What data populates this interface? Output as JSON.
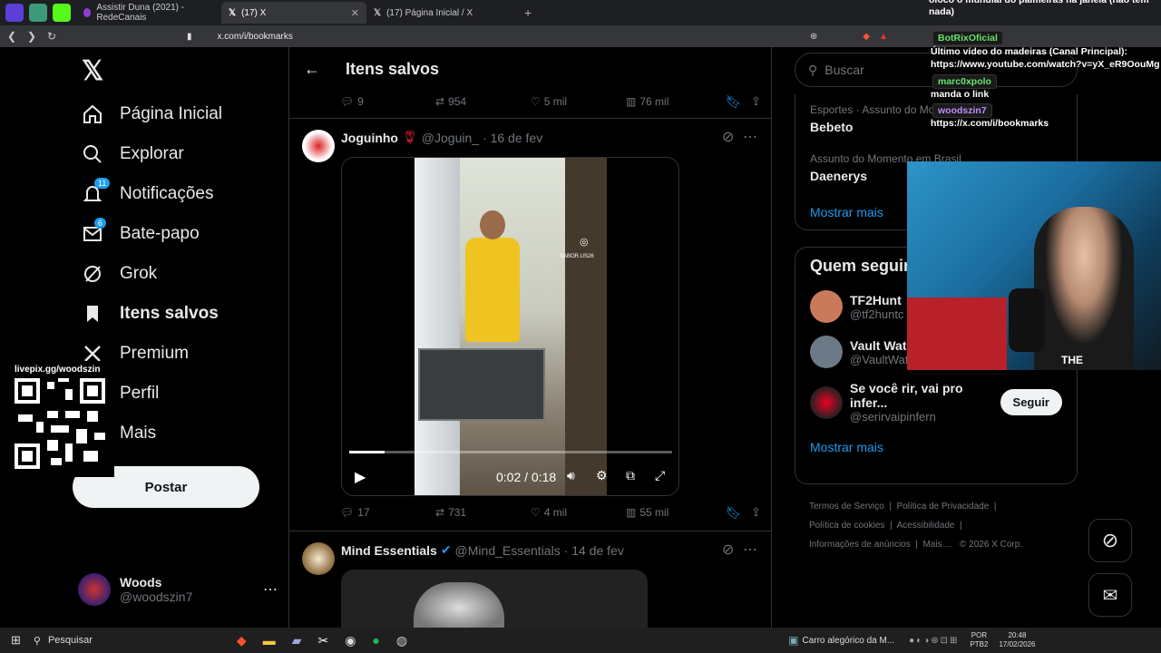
{
  "browser": {
    "tabs": [
      {
        "title": "Assistir Duna (2021) - RedeCanais",
        "active": false
      },
      {
        "title": "(17) X",
        "active": true
      },
      {
        "title": "(17) Página Inicial / X",
        "active": false
      }
    ],
    "url": "x.com/i/bookmarks"
  },
  "nav": {
    "items": [
      {
        "label": "Página Inicial",
        "icon": "home-icon",
        "badge": ""
      },
      {
        "label": "Explorar",
        "icon": "search-icon",
        "badge": ""
      },
      {
        "label": "Notificações",
        "icon": "bell-icon",
        "badge": "11"
      },
      {
        "label": "Bate-papo",
        "icon": "mail-icon",
        "badge": "6"
      },
      {
        "label": "Grok",
        "icon": "grok-icon",
        "badge": ""
      },
      {
        "label": "Itens salvos",
        "icon": "bookmark-icon",
        "badge": ""
      },
      {
        "label": "Premium",
        "icon": "x-icon",
        "badge": ""
      },
      {
        "label": "Perfil",
        "icon": "person-icon",
        "badge": ""
      },
      {
        "label": "Mais",
        "icon": "more-icon",
        "badge": ""
      }
    ],
    "post_label": "Postar",
    "account": {
      "name": "Woods",
      "handle": "@woodszin7"
    }
  },
  "timeline": {
    "header": "Itens salvos",
    "top_actions": {
      "replies": "9",
      "reposts": "954",
      "likes": "5 mil",
      "views": "76 mil"
    },
    "post1": {
      "author": "Joguinho",
      "handle": "@Joguin_",
      "date": "· 16 de fev",
      "video_time": "0:02 / 0:18",
      "video_progress": 0.11,
      "watermark": "SABOR.US26",
      "replies": "17",
      "reposts": "731",
      "likes": "4 mil",
      "views": "55 mil"
    },
    "post2": {
      "author": "Mind Essentials",
      "handle": "@Mind_Essentials",
      "date": "· 14 de fev"
    }
  },
  "right": {
    "search_placeholder": "Buscar",
    "trends": [
      {
        "meta": "Esportes · Assunto do Momento",
        "name": "Bebeto"
      },
      {
        "meta": "Assunto do Momento em Brasil",
        "name": "Daenerys"
      }
    ],
    "show_more": "Mostrar mais",
    "who_to_follow_title": "Quem seguir",
    "follow": [
      {
        "name": "TF2Hunt",
        "handle": "@tf2huntc"
      },
      {
        "name": "Vault Watc",
        "handle": "@VaultWatcher"
      },
      {
        "name": "Se você rir, vai pro infer...",
        "handle": "@serirvaipinfern",
        "button": "Seguir"
      }
    ],
    "show_more2": "Mostrar mais",
    "footer": [
      "Termos de Serviço",
      "Política de Privacidade",
      "Política de cookies",
      "Acessibilidade",
      "Informações de anúncios",
      "Mais ...",
      "© 2026 X Corp."
    ]
  },
  "chat": {
    "line0": "olocó o mundial do palmeiras na janela (não tem nada)",
    "msgs": [
      {
        "user": "BotRixOficial",
        "text": "Último vídeo do madeiras (Canal Principal): https://www.youtube.com/watch?v=yX_eR9OouMg"
      },
      {
        "user": "marc0xpolo",
        "text": "manda o link"
      },
      {
        "user": "woodszin7",
        "text": "https://x.com/i/bookmarks"
      }
    ]
  },
  "qr_label": "livepix.gg/woodszin",
  "cam_text": "THE",
  "taskbar": {
    "search": "Pesquisar",
    "app_title": "Carro alegórico da M...",
    "lang": "POR",
    "lang2": "PTB2",
    "time": "20:48",
    "date": "17/02/2026"
  }
}
